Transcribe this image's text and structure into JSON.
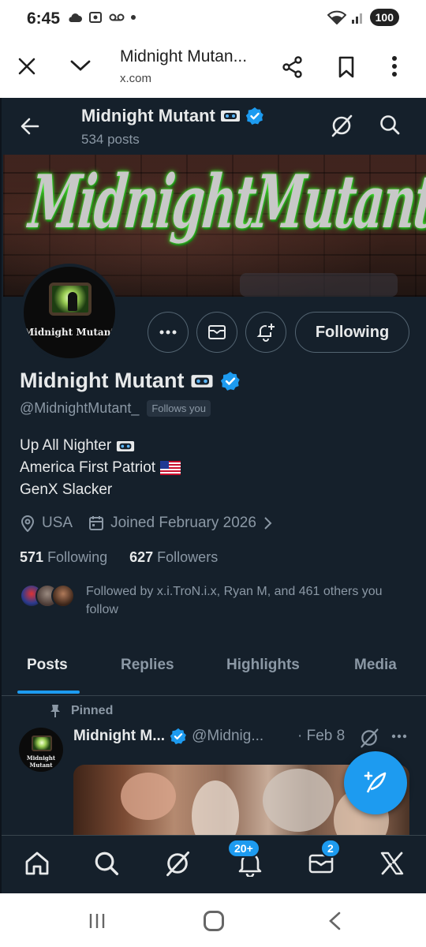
{
  "status_bar": {
    "time": "6:45",
    "battery": "100"
  },
  "browser": {
    "title": "Midnight Mutan...",
    "url": "x.com"
  },
  "profile": {
    "nav_name": "Midnight Mutant",
    "post_count": "534 posts",
    "banner_text": "MidnightMutant",
    "avatar_label": "Midnight Mutant",
    "name": "Midnight Mutant",
    "handle": "@MidnightMutant_",
    "follows_you": "Follows you",
    "following_button": "Following",
    "bio": [
      {
        "text": "Up All Nighter",
        "icon": "vhs-tape-icon"
      },
      {
        "text": "America First Patriot",
        "icon": "us-flag-icon"
      },
      {
        "text": "GenX Slacker",
        "icon": ""
      }
    ],
    "location": "USA",
    "joined": "Joined February 2026",
    "following_count": "571",
    "following_label": "Following",
    "followers_count": "627",
    "followers_label": "Followers",
    "followed_by": "Followed by x.i.TroN.i.x, Ryan M, and 461 others you follow"
  },
  "tabs": [
    {
      "label": "Posts",
      "active": true
    },
    {
      "label": "Replies",
      "active": false
    },
    {
      "label": "Highlights",
      "active": false
    },
    {
      "label": "Media",
      "active": false
    }
  ],
  "pinned_post": {
    "pinned_label": "Pinned",
    "author": "Midnight M...",
    "handle": "@Midnig...",
    "date": "· Feb 8"
  },
  "bottom_nav": {
    "notifications_badge": "20+",
    "messages_badge": "2",
    "accent_color": "#1d9bf0"
  }
}
